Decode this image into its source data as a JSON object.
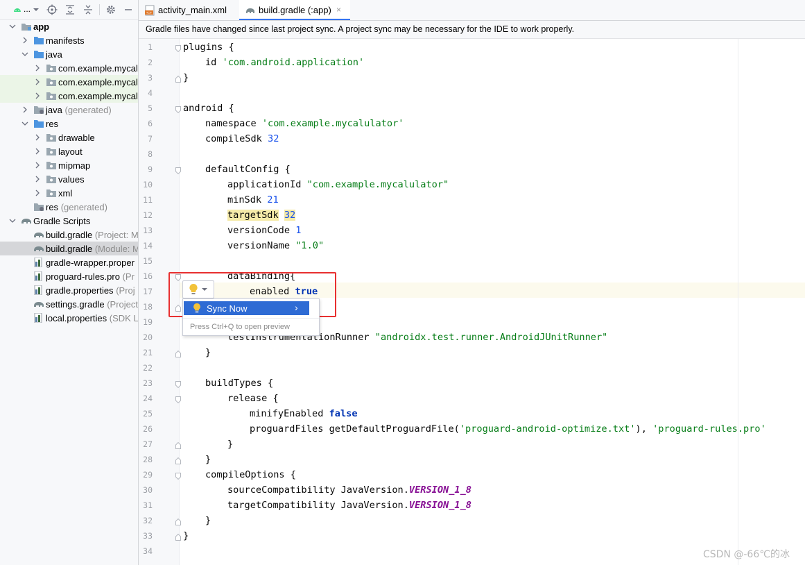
{
  "sidebar": {
    "title": "...",
    "tree": [
      {
        "label": "app",
        "hint": "",
        "bold": true
      },
      {
        "label": "manifests",
        "hint": ""
      },
      {
        "label": "java",
        "hint": ""
      },
      {
        "label": "com.example.mycalu",
        "hint": ""
      },
      {
        "label": "com.example.mycalu",
        "hint": ""
      },
      {
        "label": "com.example.mycalu",
        "hint": ""
      },
      {
        "label": "java",
        "hint": "(generated)"
      },
      {
        "label": "res",
        "hint": ""
      },
      {
        "label": "drawable",
        "hint": ""
      },
      {
        "label": "layout",
        "hint": ""
      },
      {
        "label": "mipmap",
        "hint": ""
      },
      {
        "label": "values",
        "hint": ""
      },
      {
        "label": "xml",
        "hint": ""
      },
      {
        "label": "res",
        "hint": "(generated)"
      },
      {
        "label": "Gradle Scripts",
        "hint": ""
      },
      {
        "label": "build.gradle",
        "hint": "(Project: M"
      },
      {
        "label": "build.gradle",
        "hint": "(Module: M"
      },
      {
        "label": "gradle-wrapper.proper",
        "hint": ""
      },
      {
        "label": "proguard-rules.pro",
        "hint": "(Pr"
      },
      {
        "label": "gradle.properties",
        "hint": "(Proj"
      },
      {
        "label": "settings.gradle",
        "hint": "(Project"
      },
      {
        "label": "local.properties",
        "hint": "(SDK L"
      }
    ]
  },
  "tabs": [
    {
      "label": "activity_main.xml"
    },
    {
      "label": "build.gradle (:app)",
      "close": "×"
    }
  ],
  "notification": "Gradle files have changed since last project sync. A project sync may be necessary for the IDE to work properly.",
  "editor": {
    "line_numbers": [
      "1",
      "2",
      "3",
      "4",
      "5",
      "6",
      "7",
      "8",
      "9",
      "10",
      "11",
      "12",
      "13",
      "14",
      "15",
      "16",
      "17",
      "18",
      "19",
      "20",
      "21",
      "22",
      "23",
      "24",
      "25",
      "26",
      "27",
      "28",
      "29",
      "30",
      "31",
      "32",
      "33",
      "34"
    ],
    "lines": {
      "l1": [
        "plugins {"
      ],
      "l2": [
        "id ",
        "'com.android.application'"
      ],
      "l3": [
        "}"
      ],
      "l5": [
        "android {"
      ],
      "l6": [
        "namespace ",
        "'com.example.mycalulator'"
      ],
      "l7": [
        "compileSdk ",
        "32"
      ],
      "l9": [
        "defaultConfig {"
      ],
      "l10": [
        "applicationId ",
        "\"com.example.mycalulator\""
      ],
      "l11": [
        "minSdk ",
        "21"
      ],
      "l12": [
        "targetSdk",
        " ",
        "32"
      ],
      "l13": [
        "versionCode ",
        "1"
      ],
      "l14": [
        "versionName ",
        "\"1.0\""
      ],
      "l16": [
        "dataBinding{"
      ],
      "l17": [
        "enabled ",
        "true"
      ],
      "l20": [
        "testInstrumentationRunner ",
        "\"androidx.test.runner.AndroidJUnitRunner\""
      ],
      "l21": [
        "}"
      ],
      "l23": [
        "buildTypes {"
      ],
      "l24": [
        "release {"
      ],
      "l25": [
        "minifyEnabled ",
        "false"
      ],
      "l26": [
        "proguardFiles getDefaultProguardFile(",
        "'proguard-android-optimize.txt'",
        "), ",
        "'proguard-rules.pro'"
      ],
      "l27": [
        "}"
      ],
      "l28": [
        "}"
      ],
      "l29": [
        "compileOptions {"
      ],
      "l30": [
        "sourceCompatibility JavaVersion.",
        "VERSION_1_8"
      ],
      "l31": [
        "targetCompatibility JavaVersion.",
        "VERSION_1_8"
      ],
      "l32": [
        "}"
      ],
      "l33": [
        "}"
      ]
    }
  },
  "popup": {
    "item": "Sync Now",
    "arrow": "›",
    "hint": "Press Ctrl+Q to open preview"
  },
  "watermark": "CSDN @-66℃的冰",
  "colors": {
    "accent": "#2e6bd4",
    "string": "#067d17",
    "number": "#1750eb",
    "keyword": "#0033b3",
    "constant": "#871094",
    "highlight_box": "#e83030"
  }
}
